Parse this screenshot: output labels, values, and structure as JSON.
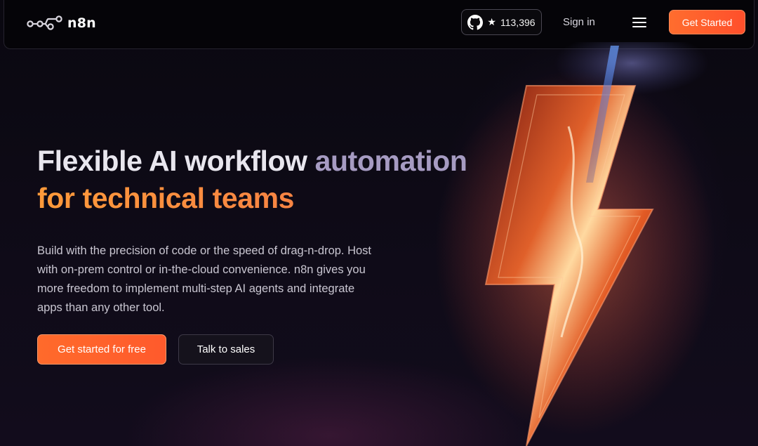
{
  "nav": {
    "logo_text": "n8n",
    "github": {
      "icon": "github-icon",
      "star_icon": "star-icon",
      "count": "113,396"
    },
    "sign_in": "Sign in",
    "menu_icon": "hamburger-menu-icon",
    "cta": "Get Started"
  },
  "hero": {
    "title_part1": "Flexible AI workflow ",
    "title_part2": "automation",
    "title_line2": "for technical teams",
    "description": "Build with the precision of code or the speed of drag-n-drop. Host with on-prem control or in-the-cloud convenience. n8n gives you more freedom to implement multi-step AI agents and integrate apps than any other tool.",
    "primary_button": "Get started for free",
    "secondary_button": "Talk to sales"
  },
  "colors": {
    "accent_orange": "#ff6a2b",
    "title_purple": "#a69bc2",
    "title_orange": "#ff8a3c",
    "background": "#0e0b16"
  }
}
